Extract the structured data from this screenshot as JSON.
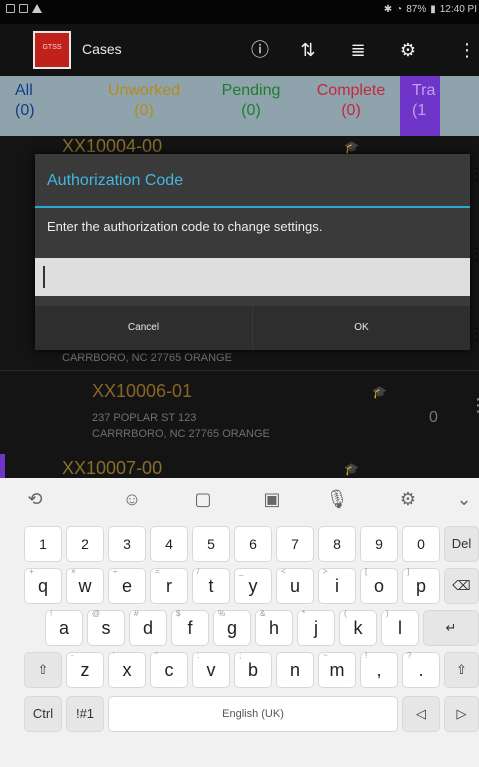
{
  "status": {
    "battery": "87%",
    "time": "12:40 PI"
  },
  "app": {
    "title": "Cases",
    "logo_text": "GTSS"
  },
  "tabs": [
    {
      "label": "All",
      "count": "(0)"
    },
    {
      "label": "Unworked",
      "count": "(0)"
    },
    {
      "label": "Pending",
      "count": "(0)"
    },
    {
      "label": "Complete",
      "count": "(0)"
    },
    {
      "label": "Tra",
      "count": "(1"
    }
  ],
  "cases": [
    {
      "code": "XX10004-00"
    },
    {
      "addr2": "CARRBORO, NC 27765 ORANGE"
    },
    {
      "code": "XX10006-01",
      "addr1": "237 POPLAR ST 123",
      "addr2": "CARRRBORO, NC 27765 ORANGE",
      "count": "0"
    },
    {
      "code": "XX10007-00"
    }
  ],
  "dialog": {
    "title": "Authorization Code",
    "message": "Enter the authorization code to change settings.",
    "input_value": "",
    "cancel_label": "Cancel",
    "ok_label": "OK"
  },
  "keyboard": {
    "numbers": [
      "1",
      "2",
      "3",
      "4",
      "5",
      "6",
      "7",
      "8",
      "9",
      "0"
    ],
    "del": "Del",
    "row1": [
      "q",
      "w",
      "e",
      "r",
      "t",
      "y",
      "u",
      "i",
      "o",
      "p"
    ],
    "row1_hints": [
      "+",
      "×",
      "÷",
      "=",
      "/",
      "_",
      "<",
      ">",
      "[",
      "]"
    ],
    "row2": [
      "a",
      "s",
      "d",
      "f",
      "g",
      "h",
      "j",
      "k",
      "l"
    ],
    "row2_hints": [
      "!",
      "@",
      "#",
      "$",
      "%",
      "&",
      "*",
      "(",
      ")"
    ],
    "row3": [
      "z",
      "x",
      "c",
      "v",
      "b",
      "n",
      "m",
      ",",
      "."
    ],
    "row3_hints": [
      "-",
      "'",
      "\"",
      ":",
      ";",
      "",
      "~",
      "!",
      "?"
    ],
    "ctrl": "Ctrl",
    "symbols": "!#1",
    "space": "English (UK)"
  }
}
